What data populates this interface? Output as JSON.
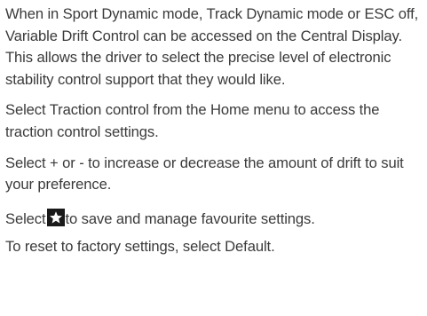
{
  "paragraphs": {
    "p1": "When in Sport Dynamic mode, Track Dynamic mode or ESC off, Variable Drift Control can be accessed on the Central Display. This allows the driver to select the precise level of electronic stability control support that they would like.",
    "p2": "Select Traction control from the Home menu to access the traction control settings.",
    "p3": "Select + or - to increase or decrease the amount of drift to suit your preference.",
    "p4_before": "Select",
    "p4_after": "to save and manage favourite settings.",
    "p5_before": "To reset to factory settings, select ",
    "p5_term": "Default",
    "p5_after": "."
  },
  "icons": {
    "favourite": "star-icon"
  }
}
